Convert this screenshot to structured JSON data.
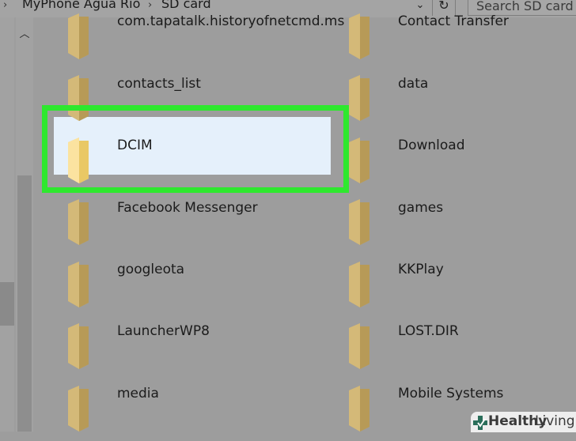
{
  "breadcrumb": {
    "items": [
      "MyPhone Agua Rio",
      "SD card"
    ]
  },
  "search": {
    "placeholder": "Search SD card"
  },
  "icons": {
    "dropdown": "chevron-down-icon",
    "refresh": "refresh-icon",
    "scroll_up": "chevron-up-icon",
    "folder": "folder-icon"
  },
  "files": {
    "left": [
      "com.tapatalk.historyofnetcmd.ms",
      "contacts_list",
      "DCIM",
      "Facebook Messenger",
      "googleota",
      "LauncherWP8",
      "media"
    ],
    "right": [
      "Contact Transfer",
      "data",
      "Download",
      "games",
      "KKPlay",
      "LOST.DIR",
      "Mobile Systems"
    ]
  },
  "selected_item": "DCIM",
  "colors": {
    "highlight": "#2ee82e",
    "selection": "#e5f0fb",
    "folder": "#cdb070"
  },
  "watermark": {
    "brand_bold": "Healthy",
    "brand_light": "Living"
  }
}
